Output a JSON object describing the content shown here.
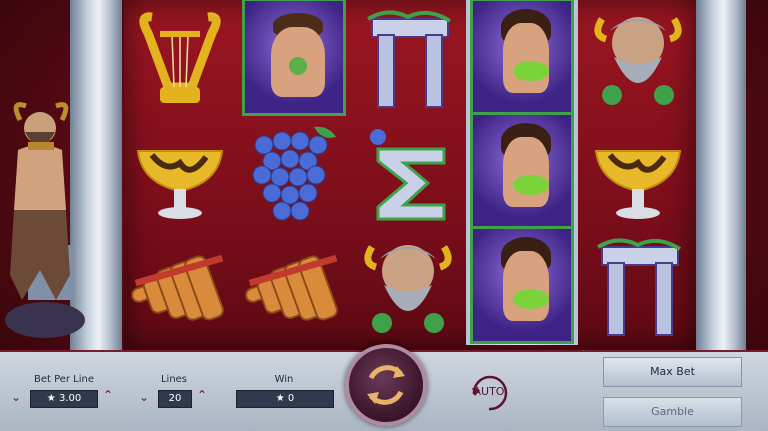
{
  "controls": {
    "bet_per_line": {
      "label": "Bet Per Line",
      "value": "3.00",
      "value_icon": "★"
    },
    "lines": {
      "label": "Lines",
      "value": "20"
    },
    "win": {
      "label": "Win",
      "value": "0",
      "value_icon": "★"
    },
    "auto_label": "AUTO",
    "max_bet_label": "Max Bet",
    "gamble_label": "Gamble"
  },
  "reels": [
    [
      "lyre",
      "cup",
      "pan-flute"
    ],
    [
      "man-portrait",
      "grapes",
      "pan-flute"
    ],
    [
      "pi-letter",
      "sigma-letter",
      "satyr-head"
    ],
    [
      "nymph-portrait",
      "nymph-portrait",
      "nymph-portrait"
    ],
    [
      "satyr-head",
      "cup",
      "pi-letter"
    ]
  ],
  "colors": {
    "background_red": "#7b0e1a",
    "highlight_green": "#3fa24a",
    "gold": "#e3b21f",
    "control_bar": "#bcc5d1"
  }
}
